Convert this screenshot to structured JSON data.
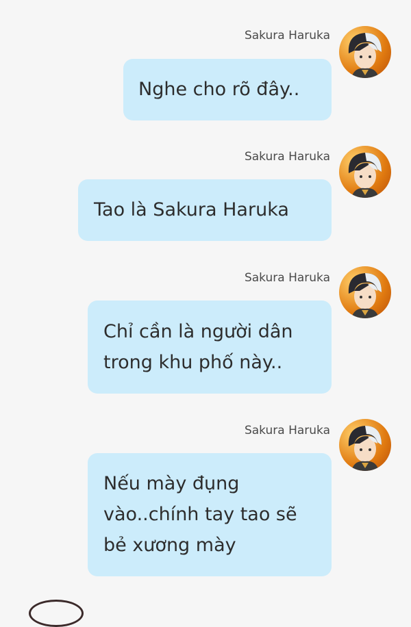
{
  "messages": [
    {
      "sender": "Sakura Haruka",
      "lines": [
        "Nghe cho rõ đây.."
      ]
    },
    {
      "sender": "Sakura Haruka",
      "lines": [
        "Tao là Sakura Haruka"
      ]
    },
    {
      "sender": "Sakura Haruka",
      "lines": [
        "Chỉ cần là người dân",
        "trong khu phố này.."
      ]
    },
    {
      "sender": "Sakura Haruka",
      "lines": [
        "Nếu mày đụng",
        "vào..chính tay tao sẽ",
        "bẻ xương mày"
      ]
    }
  ],
  "avatar_icon": "character-portrait-icon",
  "colors": {
    "bubble": "#ccecfb",
    "background": "#f6f6f6",
    "avatar_ring": "#e07a10"
  }
}
